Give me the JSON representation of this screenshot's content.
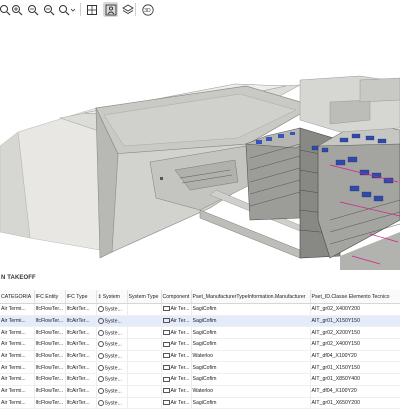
{
  "toolbar": {
    "tools": [
      {
        "icon": "zoom-in-icon",
        "name": "tool-zoom-window"
      },
      {
        "icon": "zoom-in-icon",
        "name": "tool-zoom-in"
      },
      {
        "icon": "zoom-out-icon",
        "name": "tool-zoom-out"
      },
      {
        "icon": "zoom-out-icon",
        "name": "tool-zoom-extents"
      },
      {
        "icon": "magic-wand-icon",
        "name": "tool-select-mode"
      },
      {
        "icon": "building-icon",
        "name": "tool-building-view"
      },
      {
        "icon": "person-pin-icon",
        "name": "tool-walk-mode",
        "active": true
      },
      {
        "icon": "layers-icon",
        "name": "tool-layers"
      },
      {
        "icon": "3d-icon",
        "name": "tool-3d-view",
        "label": "3D"
      }
    ]
  },
  "panel": {
    "title": "N TAKEOFF"
  },
  "table": {
    "columns": [
      "CATEGORIA",
      "IFC Entity",
      "IFC Type",
      "System",
      "System Type",
      "Component",
      "Pset_ManufacturerTypeInformation.Manufacturer",
      "Pset_ID.Classe Elemento Tecnico"
    ],
    "rows": [
      [
        "Air Termi...",
        "IfcFlowTer...",
        "IfcAirTer...",
        "Syste...",
        "",
        "Air Ter...",
        "SagiCofim",
        "AIT_gr02_X400Y200"
      ],
      [
        "Air Termi...",
        "IfcFlowTer...",
        "IfcAirTer...",
        "Syste...",
        "",
        "Air Ter...",
        "SagiCofim",
        "AIT_gr01_X150Y150"
      ],
      [
        "Air Termi...",
        "IfcFlowTer...",
        "IfcAirTer...",
        "Syste...",
        "",
        "Air Ter...",
        "SagiCofim",
        "AIT_gr02_X200Y150"
      ],
      [
        "Air Termi...",
        "IfcFlowTer...",
        "IfcAirTer...",
        "Syste...",
        "",
        "Air Ter...",
        "SagiCofim",
        "AIT_gr02_X400Y150"
      ],
      [
        "Air Termi...",
        "IfcFlowTer...",
        "IfcAirTer...",
        "Syste...",
        "",
        "Air Ter...",
        "Waterloo",
        "AIT_df04_X100Y20"
      ],
      [
        "Air Termi...",
        "IfcFlowTer...",
        "IfcAirTer...",
        "Syste...",
        "",
        "Air Ter...",
        "SagiCofim",
        "AIT_gr01_X150Y150"
      ],
      [
        "Air Termi...",
        "IfcFlowTer...",
        "IfcAirTer...",
        "Syste...",
        "",
        "Air Ter...",
        "SagiCofim",
        "AIT_gr01_X850Y400"
      ],
      [
        "Air Termi...",
        "IfcFlowTer...",
        "IfcAirTer...",
        "Syste...",
        "",
        "Air Ter...",
        "Waterloo",
        "AIT_df04_X100Y20"
      ],
      [
        "Air Termi...",
        "IfcFlowTer...",
        "IfcAirTer...",
        "Syste...",
        "",
        "Air Ter...",
        "SagiCofim",
        "AIT_gr01_X650Y200"
      ]
    ],
    "selected_row": 1
  },
  "colors": {
    "accent": "#3b78e7",
    "selected_row": "#e4ecfb",
    "roof": "#c8c8c4",
    "site": "#e9e8e4"
  }
}
